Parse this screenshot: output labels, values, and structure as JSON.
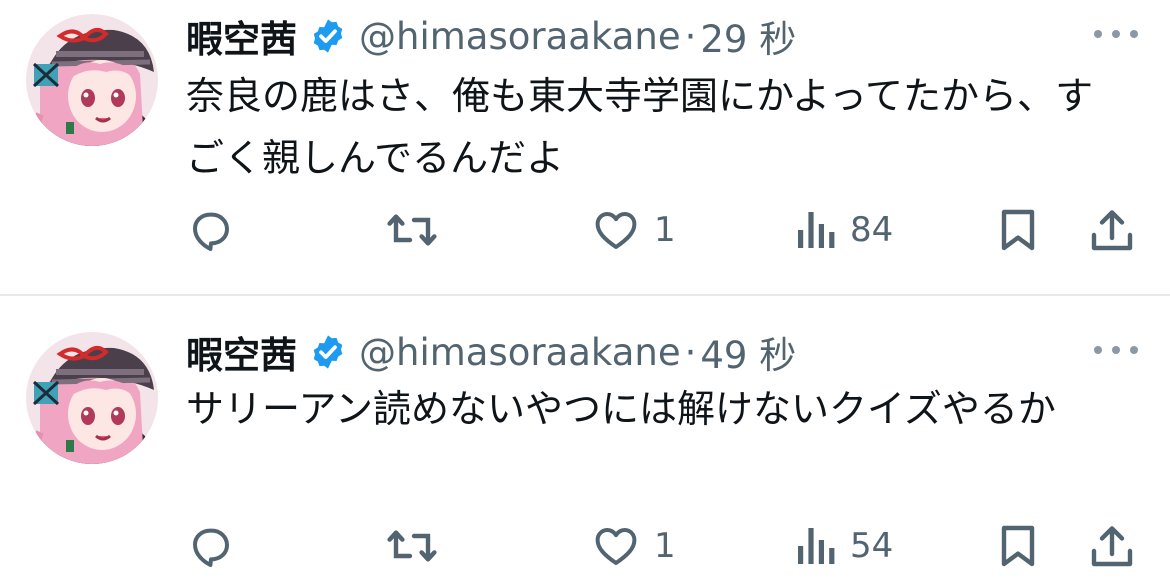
{
  "colors": {
    "verified": "#1d9bf0",
    "secondary_text": "#536471",
    "primary_text": "#0f1419",
    "divider": "#e7e9ea"
  },
  "tweets": [
    {
      "display_name": "暇空茜",
      "handle": "@himasoraakane",
      "separator": "·",
      "timestamp": "29 秒",
      "text": "奈良の鹿はさ、俺も東大寺学園にかよってたから、すごく親しんでるんだよ",
      "likes": "1",
      "views": "84",
      "icons": [
        "reply-icon",
        "retweet-icon",
        "like-icon",
        "views-icon",
        "bookmark-icon",
        "share-icon",
        "more-icon"
      ]
    },
    {
      "display_name": "暇空茜",
      "handle": "@himasoraakane",
      "separator": "·",
      "timestamp": "49 秒",
      "text": "サリーアン読めないやつには解けないクイズやるか",
      "likes": "1",
      "views": "54",
      "icons": [
        "reply-icon",
        "retweet-icon",
        "like-icon",
        "views-icon",
        "bookmark-icon",
        "share-icon",
        "more-icon"
      ]
    }
  ]
}
